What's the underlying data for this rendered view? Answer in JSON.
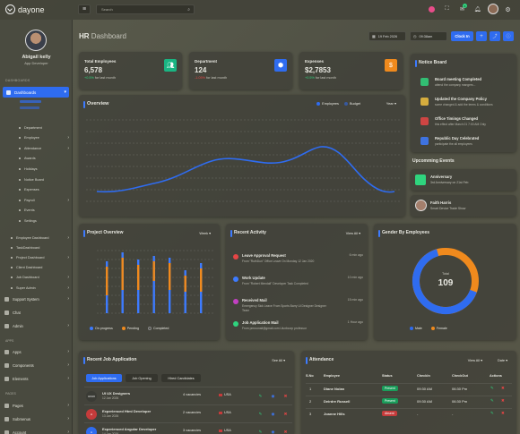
{
  "brand": {
    "name": "dayone"
  },
  "topbar": {
    "search_placeholder": "Search",
    "date": "19 Feb 2026",
    "time": "09:38am",
    "clockin_label": "Clock In",
    "badge_count": "3"
  },
  "user": {
    "name": "Abigail kelly",
    "role": "App Developer"
  },
  "sidebar": {
    "section_dashboards": "DASHBOARDS",
    "dashboards_label": "Dashboards",
    "sub_items": [
      "Department",
      "Employee",
      "Attendance",
      "Awards",
      "Holidays",
      "Notice Board",
      "Expenses",
      "Payroll",
      "Events",
      "Settings"
    ],
    "sub_chevrons": [
      false,
      true,
      true,
      false,
      false,
      false,
      false,
      true,
      false,
      false
    ],
    "more_items": [
      "Employee Dashboard",
      "TaskDashboard",
      "Project Dashboard",
      "Client Dashboard",
      "Job Dashboard",
      "Super Admin"
    ],
    "more_chevrons": [
      true,
      false,
      true,
      false,
      true,
      true
    ],
    "support_label": "Support System",
    "chat_label": "Chat",
    "admin_label": "Admin",
    "section_apps": "APPS",
    "apps_items": [
      "Apps",
      "Components",
      "Elements"
    ],
    "section_pages": "PAGES",
    "pages_items": [
      "Pages",
      "Submenus",
      "Account"
    ]
  },
  "page": {
    "title_strong": "HR",
    "title_light": "Dashboard"
  },
  "stats": [
    {
      "title": "Total Employees",
      "value": "6,578",
      "delta": "+0.5%",
      "note": "for last month",
      "color": "#1ab583",
      "icon": "users-icon"
    },
    {
      "title": "Department",
      "value": "124",
      "delta": "-1.05%",
      "note": "for last month",
      "color": "#2f6cf0",
      "icon": "cube-icon"
    },
    {
      "title": "Expenses",
      "value": "$2,7853",
      "delta": "+0.5%",
      "note": "for last month",
      "color": "#f08a1d",
      "icon": "dollar-icon"
    }
  ],
  "overview": {
    "title": "Overview",
    "legend": [
      "Employees",
      "Budget"
    ],
    "period": "Year"
  },
  "notice": {
    "title": "Notice Board",
    "items": [
      {
        "title": "Board meeting Completed",
        "desc": "attend the company mangers...",
        "color": "#2fd47e"
      },
      {
        "title": "Updated the Company Policy",
        "desc": "some changed & add the terms & conditions",
        "color": "#f0c040"
      },
      {
        "title": "Office Timings Changed",
        "desc": "this effect after March 01 7:00 AM Only",
        "color": "#e64545"
      },
      {
        "title": "Republic Day Celebrated",
        "desc": "participate the all employees",
        "color": "#3d7bff"
      }
    ]
  },
  "events": {
    "title": "Upcomming Events",
    "items": [
      {
        "title": "Anniversary",
        "desc": "3rd Anniversary on 21st Feb"
      },
      {
        "title": "Faith Harris",
        "desc": "Smart Device Trade Show"
      }
    ]
  },
  "project": {
    "title": "Project Overview",
    "period": "Week",
    "legend": [
      "On progress",
      "Pending",
      "Completed"
    ],
    "colors": {
      "progress": "#3d7bff",
      "pending": "#f08a1d",
      "completed": "#4a4b44"
    }
  },
  "activity": {
    "title": "Recent Activity",
    "view_all": "View All",
    "items": [
      {
        "title": "Leave Approval Request",
        "desc": "From \"RuthDun\" Office Leave On Monday 12 Jan 2020",
        "time": "6 min ago",
        "color": "#e64545"
      },
      {
        "title": "Work Update",
        "desc": "From \"Robert Mendall\" Developer Task Completed",
        "time": "10 min ago",
        "color": "#3d7bff"
      },
      {
        "title": "Received Mail",
        "desc": "Emergency Sick Leave From Sports Barry Ui Designer Designer Team",
        "time": "15 min ago",
        "color": "#c240c2"
      },
      {
        "title": "Job Application Mail",
        "desc": "From pmroonail@gmail.com Uiuxbcorp professor",
        "time": "1 Hour ago",
        "color": "#2fd47e"
      }
    ]
  },
  "gender": {
    "title": "Gender By Employees",
    "total_label": "Total",
    "total": "109",
    "legend": [
      "Male",
      "Female"
    ],
    "male_pct": 65,
    "female_pct": 35
  },
  "jobs": {
    "title": "Recent Job Application",
    "see_all": "See All",
    "tabs": [
      "Job Applications",
      "Job Opening",
      "Hired Candidates"
    ],
    "rows": [
      {
        "logo": "UI/UX",
        "title": "UI UX Designers",
        "date": "12 Jan 2026",
        "vacancies": "4 vacancies",
        "country": "USA"
      },
      {
        "logo": "H",
        "title": "Experienced Html Developer",
        "date": "13 Jan 2026",
        "vacancies": "2 vacancies",
        "country": "USA"
      },
      {
        "logo": "A",
        "title": "Experienced Angular Developer",
        "date": "14 Jan 2026",
        "vacancies": "3 vacancies",
        "country": "USA"
      }
    ]
  },
  "attendance": {
    "title": "Attendance",
    "view_all": "View All",
    "filter": "Date",
    "headers": [
      "S.No",
      "Employee",
      "Status",
      "CheckIn",
      "CheckOut",
      "Actions"
    ],
    "rows": [
      {
        "no": "1",
        "name": "Diane Nolan",
        "status": "Present",
        "in": "09:30 AM",
        "out": "06:30 Pm",
        "color": "#1a9c5a"
      },
      {
        "no": "2",
        "name": "Deirdre Russell",
        "status": "Present",
        "in": "09:30 AM",
        "out": "06:30 Pm",
        "color": "#1a9c5a"
      },
      {
        "no": "3",
        "name": "Joanne Hills",
        "status": "Absent",
        "in": "-",
        "out": "-",
        "color": "#c53b3b"
      }
    ]
  }
}
